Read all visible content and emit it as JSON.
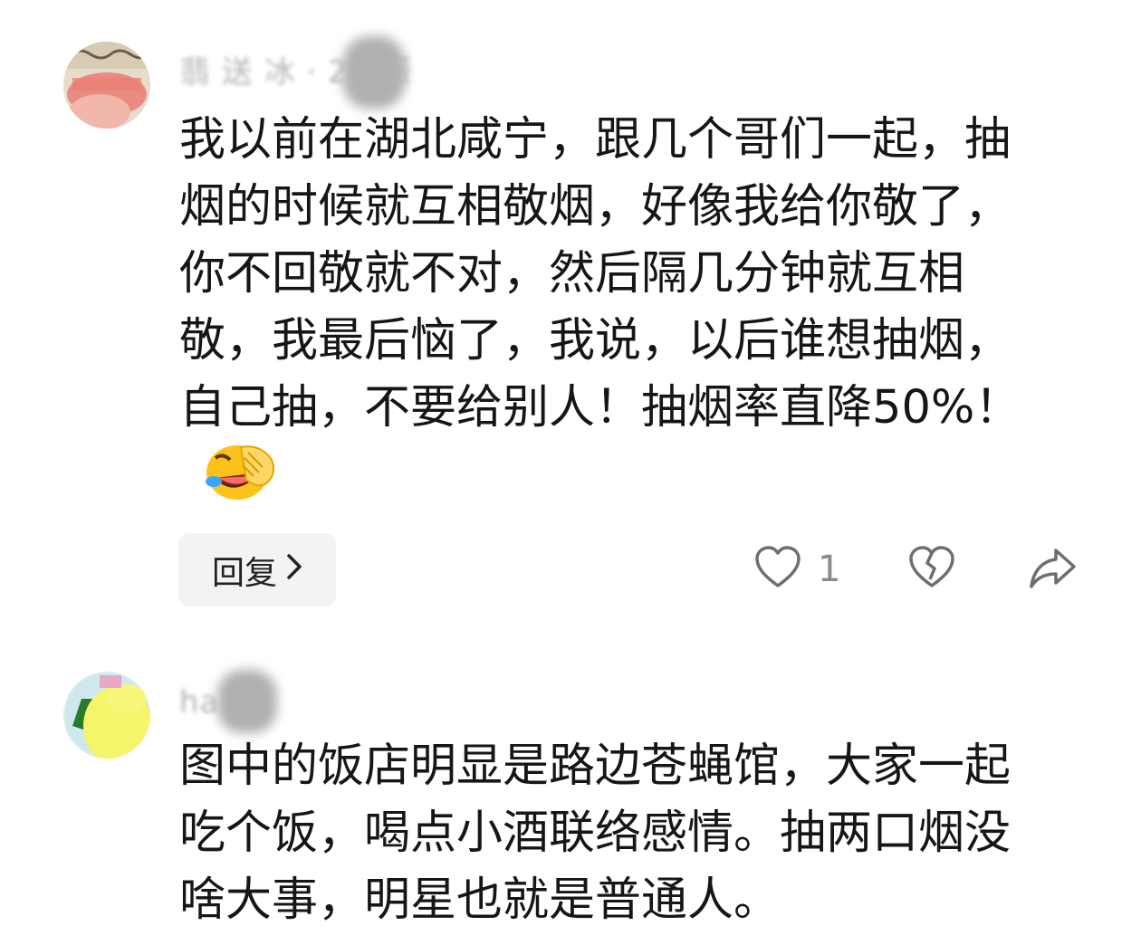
{
  "comments": [
    {
      "username": "翡 送 冰 · 2 · 振",
      "text": "我以前在湖北咸宁，跟几个哥们一起，抽烟的时候就互相敬烟，好像我给你敬了，你不回敬就不对，然后隔几分钟就互相敬，我最后恼了，我说，以后谁想抽烟，自己抽，不要给别人！抽烟率直降50%！",
      "emoji": "rolling-laughing-emoji",
      "reply_label": "回复",
      "like_count": "1"
    },
    {
      "username": "ha                          每",
      "text": "图中的饭店明显是路边苍蝇馆，大家一起吃个饭，喝点小酒联络感情。抽两口烟没啥大事，明星也就是普通人。"
    }
  ],
  "icons": {
    "like": "heart-outline-icon",
    "dislike": "broken-heart-icon",
    "share": "share-arrow-icon",
    "reply_chevron": "chevron-right-icon"
  },
  "colors": {
    "text": "#161616",
    "muted": "#8a8a8a",
    "button_bg": "#f3f3f3"
  }
}
